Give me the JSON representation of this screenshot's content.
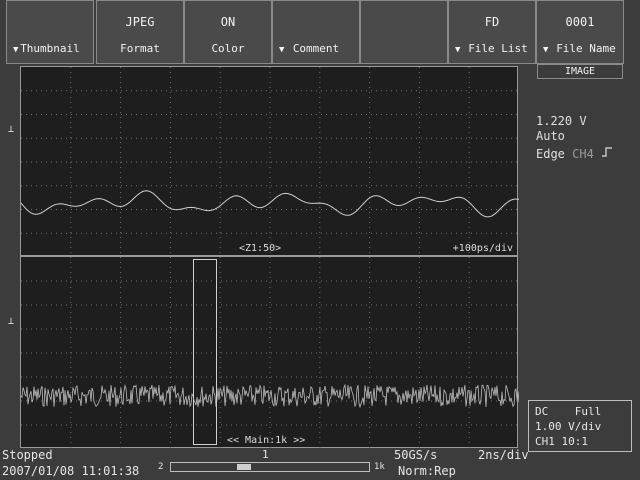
{
  "softkeys": [
    {
      "label": "Thumbnail",
      "value": "",
      "arrow": true
    },
    {
      "label": "Format",
      "value": "JPEG",
      "arrow": false
    },
    {
      "label": "Color",
      "value": "ON",
      "arrow": false
    },
    {
      "label": "Comment",
      "value": "",
      "arrow": true
    },
    {
      "label": "",
      "value": "",
      "arrow": false
    },
    {
      "label": "File List",
      "value": "FD",
      "arrow": true
    },
    {
      "label": "File Name",
      "value": "0001",
      "arrow": true,
      "sub": "IMAGE"
    }
  ],
  "upper_panel": {
    "ground_marker": "⊥",
    "zoom_label": "<Z1:50>",
    "timebase": "+100ps/div"
  },
  "lower_panel": {
    "ground_marker": "⊥",
    "main_label": "<< Main:1k >>"
  },
  "trigger": {
    "level": "1.220 V",
    "mode": "Auto",
    "type": "Edge",
    "channel": "CH4",
    "slope_icon": "rising-edge"
  },
  "channel_info": {
    "coupling": "DC",
    "bandwidth": "Full",
    "vdiv": "1.00 V/div",
    "channel": "CH1",
    "probe": "10:1"
  },
  "status": {
    "state": "Stopped",
    "datetime": "2007/01/08 11:01:38",
    "sample_rate": "50GS/s",
    "timebase": "2ns/div",
    "acq_mode": "Norm:Rep",
    "record_left": "2",
    "record_right": "1k",
    "trigger_marker": "1"
  },
  "colors": {
    "background": "#3c3c3c",
    "screen": "#1e1e1e",
    "trace": "#cfcfcf",
    "grid": "#7a7a7a"
  }
}
